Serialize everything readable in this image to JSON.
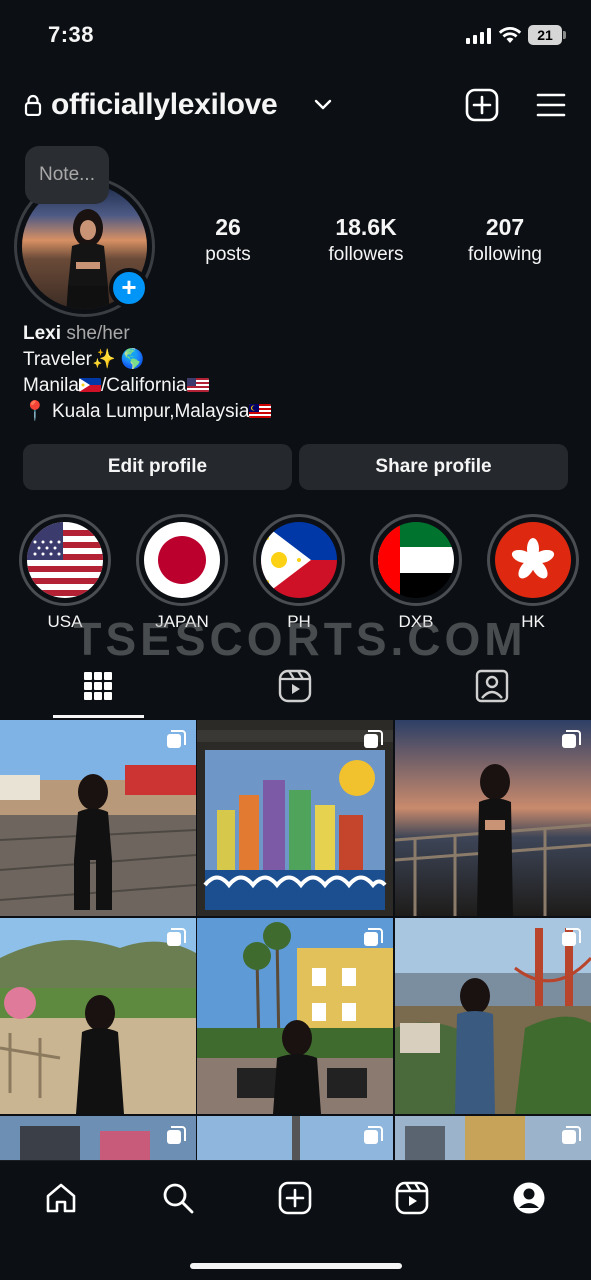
{
  "status_bar": {
    "time": "7:38",
    "battery": "21"
  },
  "header": {
    "username": "officiallylexilove"
  },
  "profile": {
    "note_placeholder": "Note...",
    "stats": [
      {
        "value": "26",
        "label": "posts"
      },
      {
        "value": "18.6K",
        "label": "followers"
      },
      {
        "value": "207",
        "label": "following"
      }
    ]
  },
  "bio": {
    "name": "Lexi",
    "pronouns": "she/her",
    "line1": "Traveler✨ 🌎",
    "line2_a": "Manila",
    "line2_b": "/California",
    "line3_pin": "📍",
    "line3": " Kuala Lumpur,Malaysia"
  },
  "actions": {
    "edit": "Edit profile",
    "share": "Share profile"
  },
  "highlights": [
    {
      "label": "USA",
      "flag": "usa-flag-icon"
    },
    {
      "label": "JAPAN",
      "flag": "japan-flag-icon"
    },
    {
      "label": "PH",
      "flag": "philippines-flag-icon"
    },
    {
      "label": "DXB",
      "flag": "uae-flag-icon"
    },
    {
      "label": "HK",
      "flag": "hongkong-flag-icon"
    }
  ],
  "watermark": "TSESCORTS.COM",
  "tabs": [
    "posts-grid-icon",
    "reels-icon",
    "tagged-icon"
  ],
  "grid_posts": [
    {
      "scene": "boardwalk pier street",
      "multi": true
    },
    {
      "scene": "los angeles city mural",
      "multi": true
    },
    {
      "scene": "sunset beach railing",
      "multi": true
    },
    {
      "scene": "hollywood hills park",
      "multi": true
    },
    {
      "scene": "palm trees street cafe",
      "multi": true
    },
    {
      "scene": "golden gate bridge view",
      "multi": true
    }
  ],
  "bottom_nav": [
    "home-icon",
    "search-icon",
    "create-icon",
    "reels-icon",
    "profile-icon"
  ],
  "colors": {
    "background": "#0c1014",
    "button": "#25292e",
    "accent": "#0095f6"
  }
}
